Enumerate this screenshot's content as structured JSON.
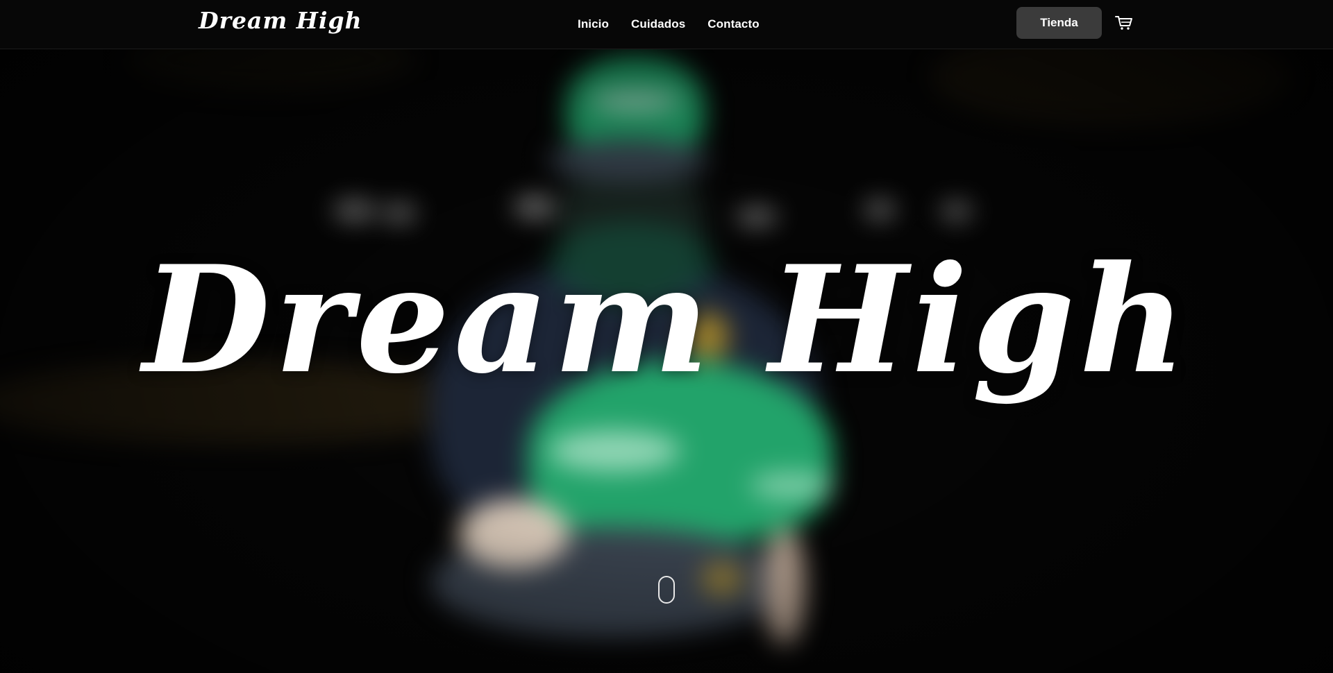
{
  "header": {
    "logo": "Dream High",
    "nav": [
      {
        "label": "Inicio"
      },
      {
        "label": "Cuidados"
      },
      {
        "label": "Contacto"
      }
    ],
    "shop_button": "Tienda",
    "cart_icon": "cart-icon"
  },
  "hero": {
    "title": "Dream High",
    "background": "blurred photo of person wearing green and navy caps",
    "scroll_icon": "mouse-scroll-icon"
  },
  "colors": {
    "background": "#050505",
    "header": "#070707",
    "button": "#3b3b3b",
    "text": "#ffffff",
    "cap_green": "#1fa56a",
    "cap_navy": "#2a3340"
  }
}
